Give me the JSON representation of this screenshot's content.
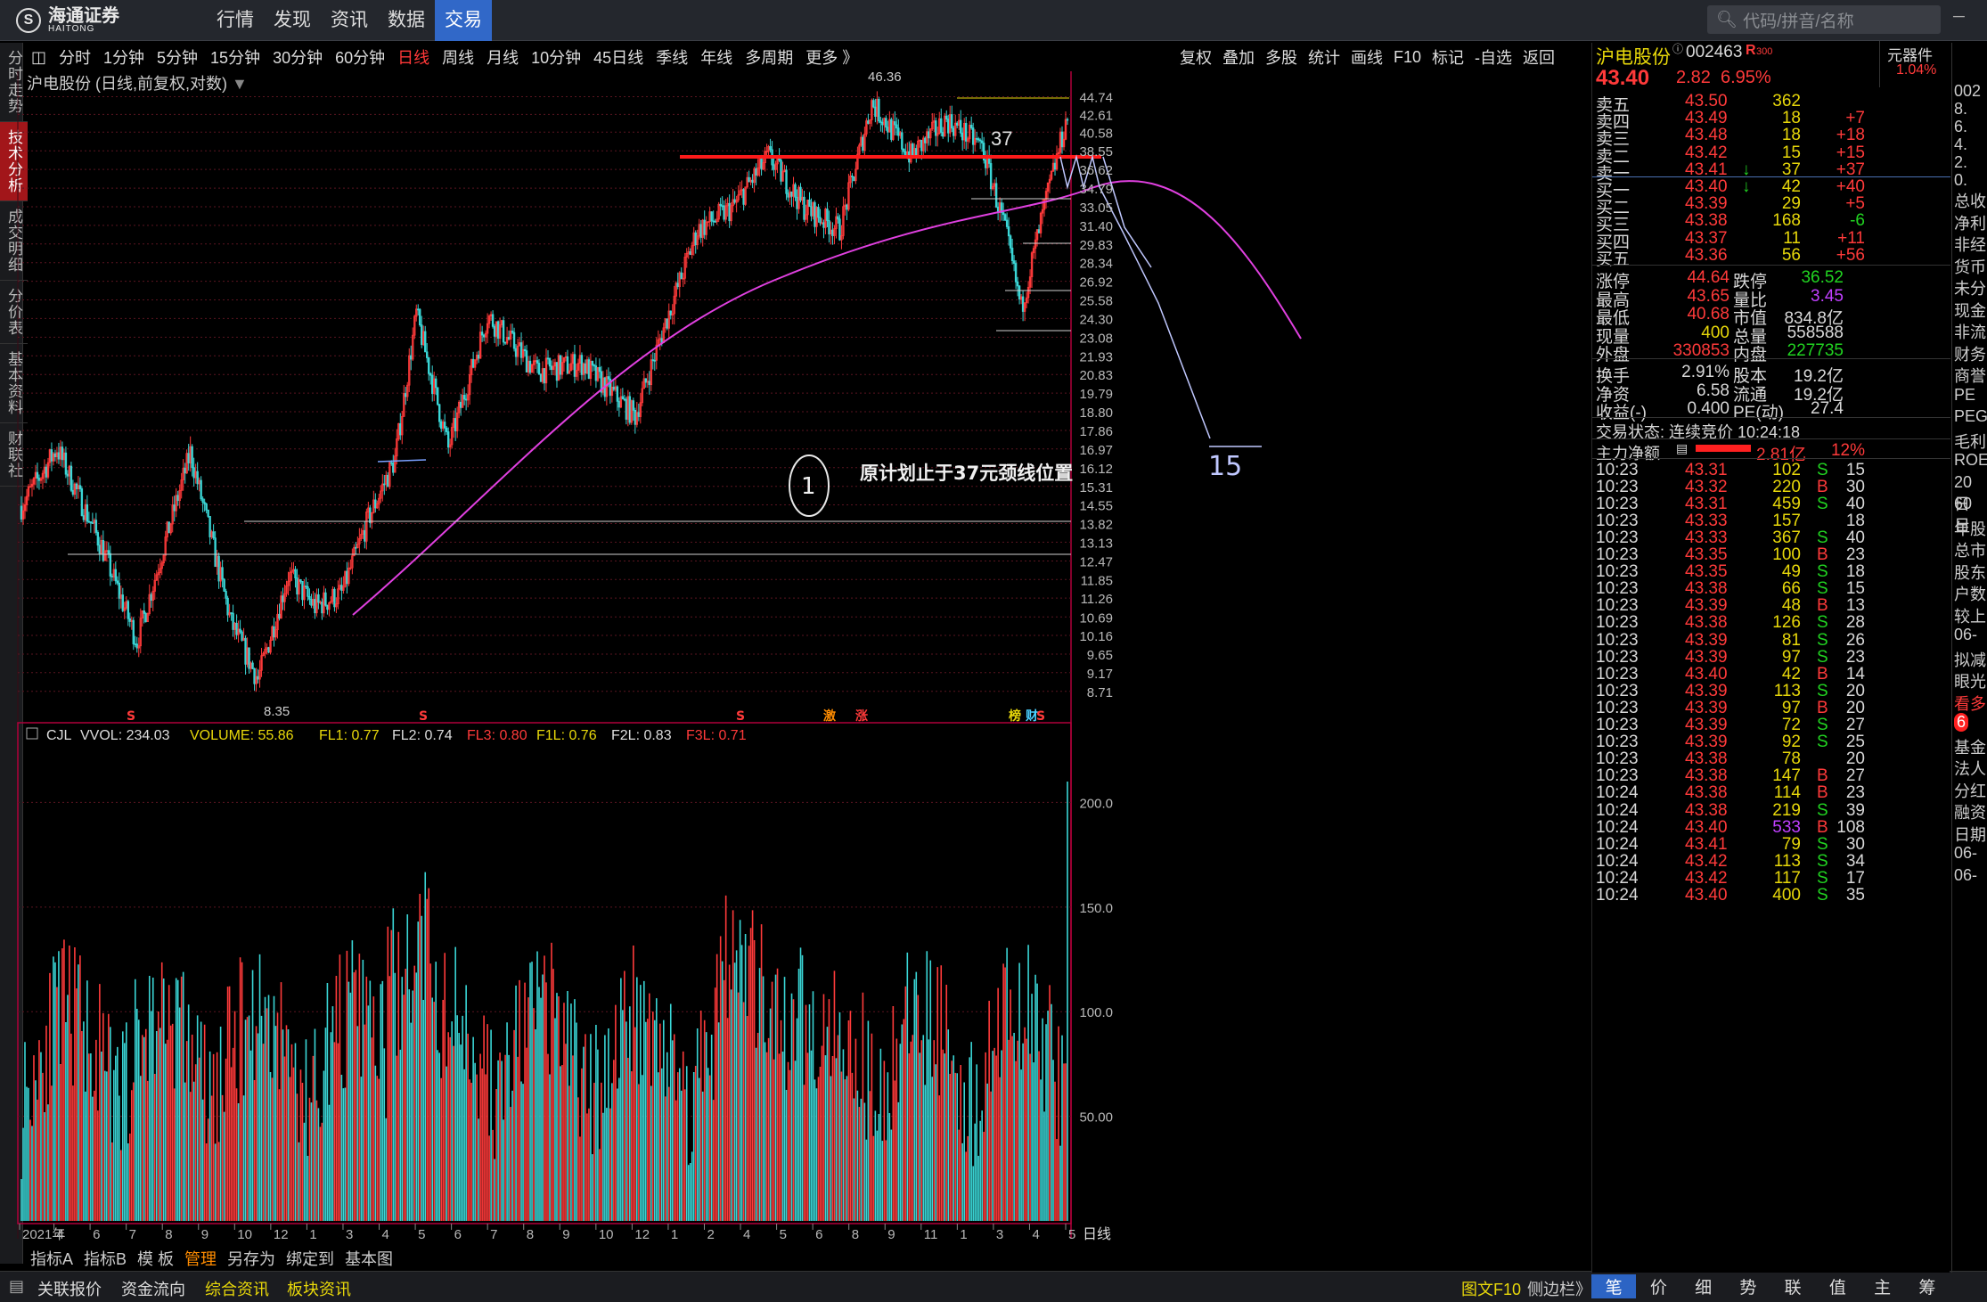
{
  "app": {
    "logo_text": "海通证券",
    "logo_sub": "HAITONG",
    "logo_mark": "S"
  },
  "nav": [
    "行情",
    "发现",
    "资讯",
    "数据",
    "交易"
  ],
  "search": {
    "placeholder": "代码/拼音/名称"
  },
  "left_tabs": [
    "分时走势",
    "技术分析",
    "成交明细",
    "分价表",
    "基本资料",
    "财联社"
  ],
  "periods": [
    "分时",
    "1分钟",
    "5分钟",
    "15分钟",
    "30分钟",
    "60分钟",
    "日线",
    "周线",
    "月线",
    "10分钟",
    "45日线",
    "季线",
    "年线",
    "多周期",
    "更多 》"
  ],
  "active_period": "日线",
  "tools": [
    "复权",
    "叠加",
    "多股",
    "统计",
    "画线",
    "F10",
    "标记",
    "-自选",
    "返回"
  ],
  "chart": {
    "title": "沪电股份 (日线,前复权,对数)",
    "price_ticks": [
      "44.74",
      "42.61",
      "40.58",
      "38.55",
      "36.62",
      "34.79",
      "33.05",
      "31.40",
      "29.83",
      "28.34",
      "26.92",
      "25.58",
      "24.30",
      "23.08",
      "21.93",
      "20.83",
      "19.79",
      "18.80",
      "17.86",
      "16.97",
      "16.12",
      "15.31",
      "14.55",
      "13.82",
      "13.13",
      "12.47",
      "11.85",
      "11.26",
      "10.69",
      "10.16",
      "9.65",
      "9.17",
      "8.71"
    ],
    "high_label": "46.36",
    "low_label": "8.35",
    "annotation_37": "37",
    "annotation_text": "原计划止于37元颈线位置",
    "annotation_circle": "1",
    "annotation_15": "15",
    "event_marks": [
      "S",
      "S",
      "S",
      "激",
      "涨",
      "榜",
      "财",
      "S"
    ],
    "x_labels": [
      "2021年",
      "4",
      "6",
      "7",
      "8",
      "9",
      "10",
      "12",
      "1",
      "3",
      "4",
      "5",
      "6",
      "7",
      "8",
      "9",
      "10",
      "12",
      "1",
      "2",
      "4",
      "5",
      "6",
      "8",
      "9",
      "11",
      "1",
      "3",
      "4",
      "5"
    ],
    "period_label": "日线"
  },
  "volume": {
    "label": "CJL",
    "vvol": "VVOL: 234.03",
    "volume": "VOLUME: 55.86",
    "fl1": "FL1: 0.77",
    "fl2": "FL2: 0.74",
    "fl3": "FL3: 0.80",
    "f1l": "F1L: 0.76",
    "f2l": "F2L: 0.83",
    "f3l": "F3L: 0.71",
    "ticks": [
      "200.0",
      "150.0",
      "100.0",
      "50.00"
    ]
  },
  "bottom_tabs": [
    "指标A",
    "指标B",
    "模 板",
    "管理",
    "另存为",
    "绑定到",
    "基本图"
  ],
  "footer": {
    "items": [
      "关联报价",
      "资金流向",
      "综合资讯",
      "板块资讯"
    ],
    "f10": "图文F10",
    "sidebar": "侧边栏》"
  },
  "quote": {
    "name": "沪电股份",
    "code": "002463",
    "badge": "R",
    "badge2": "300",
    "price": "43.40",
    "change": "2.82",
    "pct": "6.95%",
    "unit_label": "元器件",
    "unit_pct": "1.04%",
    "asks": [
      [
        "卖五",
        "43.50",
        "362",
        ""
      ],
      [
        "卖四",
        "43.49",
        "18",
        "+7"
      ],
      [
        "卖三",
        "43.48",
        "18",
        "+18"
      ],
      [
        "卖二",
        "43.42",
        "15",
        "+15"
      ],
      [
        "卖一",
        "43.41",
        "37",
        "+37"
      ]
    ],
    "bids": [
      [
        "买一",
        "43.40",
        "42",
        "+40"
      ],
      [
        "买二",
        "43.39",
        "29",
        "+5"
      ],
      [
        "买三",
        "43.38",
        "168",
        "-6"
      ],
      [
        "买四",
        "43.37",
        "11",
        "+11"
      ],
      [
        "买五",
        "43.36",
        "56",
        "+56"
      ]
    ],
    "stats": [
      [
        "涨停",
        "44.64",
        "跌停",
        "36.52"
      ],
      [
        "最高",
        "43.65",
        "量比",
        "3.45"
      ],
      [
        "最低",
        "40.68",
        "市值",
        "834.8亿"
      ],
      [
        "现量",
        "400",
        "总量",
        "558588"
      ],
      [
        "外盘",
        "330853",
        "内盘",
        "227735"
      ],
      [
        "换手",
        "2.91%",
        "股本",
        "19.2亿"
      ],
      [
        "净资",
        "6.58",
        "流通",
        "19.2亿"
      ],
      [
        "收益(-)",
        "0.400",
        "PE(动)",
        "27.4"
      ]
    ],
    "trade_status": "交易状态: 连续竞价 10:24:18",
    "main_flow": {
      "label": "主力净额",
      "value": "2.81亿",
      "pct": "12%"
    },
    "ticks": [
      [
        "10:23",
        "43.31",
        "102",
        "S",
        "15"
      ],
      [
        "10:23",
        "43.32",
        "220",
        "B",
        "30"
      ],
      [
        "10:23",
        "43.31",
        "459",
        "S",
        "40"
      ],
      [
        "10:23",
        "43.33",
        "157",
        "",
        "18"
      ],
      [
        "10:23",
        "43.33",
        "367",
        "S",
        "40"
      ],
      [
        "10:23",
        "43.35",
        "100",
        "B",
        "23"
      ],
      [
        "10:23",
        "43.35",
        "49",
        "S",
        "18"
      ],
      [
        "10:23",
        "43.38",
        "66",
        "S",
        "15"
      ],
      [
        "10:23",
        "43.39",
        "48",
        "B",
        "13"
      ],
      [
        "10:23",
        "43.38",
        "126",
        "S",
        "28"
      ],
      [
        "10:23",
        "43.39",
        "81",
        "S",
        "26"
      ],
      [
        "10:23",
        "43.39",
        "97",
        "S",
        "23"
      ],
      [
        "10:23",
        "43.40",
        "42",
        "B",
        "14"
      ],
      [
        "10:23",
        "43.39",
        "113",
        "S",
        "20"
      ],
      [
        "10:23",
        "43.39",
        "97",
        "B",
        "20"
      ],
      [
        "10:23",
        "43.39",
        "72",
        "S",
        "27"
      ],
      [
        "10:23",
        "43.39",
        "92",
        "S",
        "25"
      ],
      [
        "10:23",
        "43.38",
        "78",
        "",
        "20"
      ],
      [
        "10:23",
        "43.38",
        "147",
        "B",
        "27"
      ],
      [
        "10:24",
        "43.38",
        "114",
        "B",
        "23"
      ],
      [
        "10:24",
        "43.38",
        "219",
        "S",
        "39"
      ],
      [
        "10:24",
        "43.40",
        "533",
        "B",
        "108"
      ],
      [
        "10:24",
        "43.41",
        "79",
        "S",
        "30"
      ],
      [
        "10:24",
        "43.42",
        "113",
        "S",
        "34"
      ],
      [
        "10:24",
        "43.42",
        "117",
        "S",
        "17"
      ],
      [
        "10:24",
        "43.40",
        "400",
        "S",
        "35"
      ]
    ],
    "tabs": [
      "笔",
      "价",
      "细",
      "势",
      "联",
      "值",
      "主",
      "筹"
    ]
  },
  "partial_right": [
    "002",
    "8.",
    "6.",
    "4.",
    "2.",
    "0.",
    "总收",
    "净利",
    "非经",
    "货币",
    "未分",
    "现金",
    "非流",
    "财务",
    "商誉",
    "PE",
    "PEG",
    "毛利",
    "ROE",
    "20日",
    "60日",
    "年股",
    "总市",
    "股东",
    "户数",
    "较上",
    "06-",
    "拟减",
    "眼光",
    "看多",
    "6",
    "基金",
    "法人",
    "分红",
    "融资",
    "日期",
    "06-",
    "06-"
  ]
}
